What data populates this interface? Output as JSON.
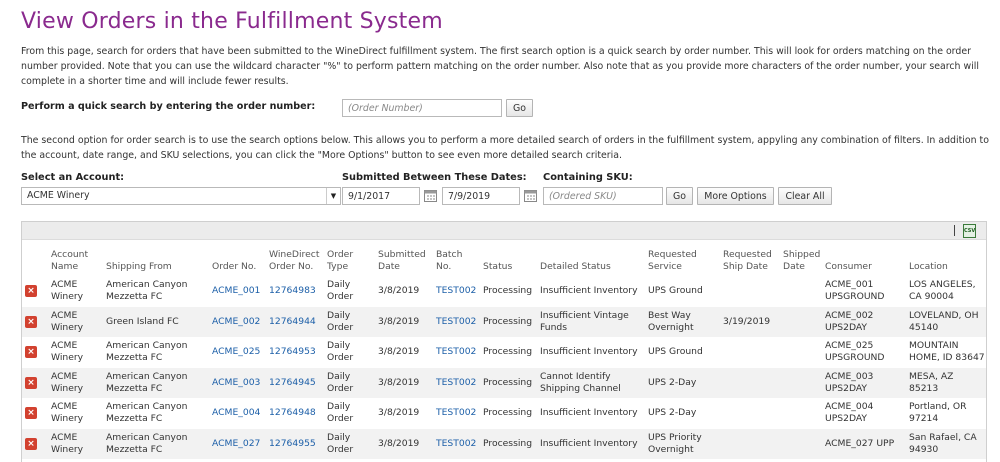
{
  "page_title": "View Orders in the Fulfillment System",
  "intro_text": "From this page, search for orders that have been submitted to the WineDirect fulfillment system. The first search option is a quick search by order number. This will look for orders matching on the order number provided. Note that you can use the wildcard character \"%\" to perform pattern matching on the order number. Also note that as you provide more characters of the order number, your search will complete in a shorter time and will include fewer results.",
  "quick_search": {
    "label": "Perform a quick search by entering the order number:",
    "placeholder": "(Order Number)",
    "go_label": "Go"
  },
  "second_text": "The second option for order search is to use the search options below. This allows you to perform a more detailed search of orders in the fulfillment system, appyling any combination of filters. In addition to the account, date range, and SKU selections, you can click the \"More Options\" button to see even more detailed search criteria.",
  "filters": {
    "account_label": "Select an Account:",
    "account_value": "ACME Winery",
    "dates_label": "Submitted Between These Dates:",
    "start_date": "9/1/2017",
    "end_date": "7/9/2019",
    "sku_label": "Containing SKU:",
    "sku_placeholder": "(Ordered SKU)",
    "go_label": "Go",
    "more_options_label": "More Options",
    "clear_all_label": "Clear All"
  },
  "table": {
    "columns": [
      "",
      "Account Name",
      "Shipping From",
      "Order No.",
      "WineDirect Order No.",
      "Order Type",
      "Submitted Date",
      "Batch No.",
      "Status",
      "Detailed Status",
      "Requested Service",
      "Requested Ship Date",
      "Shipped Date",
      "Consumer",
      "Location"
    ],
    "rows": [
      {
        "account": "ACME Winery",
        "shipping_from": "American Canyon Mezzetta FC",
        "order_no": "ACME_001",
        "wd_order_no": "12764983",
        "order_type": "Daily Order",
        "submitted": "3/8/2019",
        "batch": "TEST002",
        "status": "Processing",
        "detailed_status": "Insufficient Inventory",
        "service": "UPS Ground",
        "req_ship_date": "",
        "shipped_date": "",
        "consumer": "ACME_001 UPSGROUND",
        "location": "LOS ANGELES, CA 90004"
      },
      {
        "account": "ACME Winery",
        "shipping_from": "Green Island FC",
        "order_no": "ACME_002",
        "wd_order_no": "12764944",
        "order_type": "Daily Order",
        "submitted": "3/8/2019",
        "batch": "TEST002",
        "status": "Processing",
        "detailed_status": "Insufficient Vintage Funds",
        "service": "Best Way Overnight",
        "req_ship_date": "3/19/2019",
        "shipped_date": "",
        "consumer": "ACME_002 UPS2DAY",
        "location": "LOVELAND, OH 45140"
      },
      {
        "account": "ACME Winery",
        "shipping_from": "American Canyon Mezzetta FC",
        "order_no": "ACME_025",
        "wd_order_no": "12764953",
        "order_type": "Daily Order",
        "submitted": "3/8/2019",
        "batch": "TEST002",
        "status": "Processing",
        "detailed_status": "Insufficient Inventory",
        "service": "UPS Ground",
        "req_ship_date": "",
        "shipped_date": "",
        "consumer": "ACME_025 UPSGROUND",
        "location": "MOUNTAIN HOME, ID 83647"
      },
      {
        "account": "ACME Winery",
        "shipping_from": "American Canyon Mezzetta FC",
        "order_no": "ACME_003",
        "wd_order_no": "12764945",
        "order_type": "Daily Order",
        "submitted": "3/8/2019",
        "batch": "TEST002",
        "status": "Processing",
        "detailed_status": "Cannot Identify Shipping Channel",
        "service": "UPS 2-Day",
        "req_ship_date": "",
        "shipped_date": "",
        "consumer": "ACME_003 UPS2DAY",
        "location": "MESA, AZ 85213"
      },
      {
        "account": "ACME Winery",
        "shipping_from": "American Canyon Mezzetta FC",
        "order_no": "ACME_004",
        "wd_order_no": "12764948",
        "order_type": "Daily Order",
        "submitted": "3/8/2019",
        "batch": "TEST002",
        "status": "Processing",
        "detailed_status": "Insufficient Inventory",
        "service": "UPS 2-Day",
        "req_ship_date": "",
        "shipped_date": "",
        "consumer": "ACME_004 UPS2DAY",
        "location": "Portland, OR 97214"
      },
      {
        "account": "ACME Winery",
        "shipping_from": "American Canyon Mezzetta FC",
        "order_no": "ACME_027",
        "wd_order_no": "12764955",
        "order_type": "Daily Order",
        "submitted": "3/8/2019",
        "batch": "TEST002",
        "status": "Processing",
        "detailed_status": "Insufficient Inventory",
        "service": "UPS Priority Overnight",
        "req_ship_date": "",
        "shipped_date": "",
        "consumer": "ACME_027 UPP",
        "location": "San Rafael, CA 94930"
      }
    ]
  },
  "icons": {
    "delete": "delete-icon",
    "calendar": "calendar-icon",
    "export": "csv-export-icon"
  },
  "colors": {
    "title": "#8a2a8e",
    "link": "#1c5fa8",
    "delete": "#d2412f"
  }
}
